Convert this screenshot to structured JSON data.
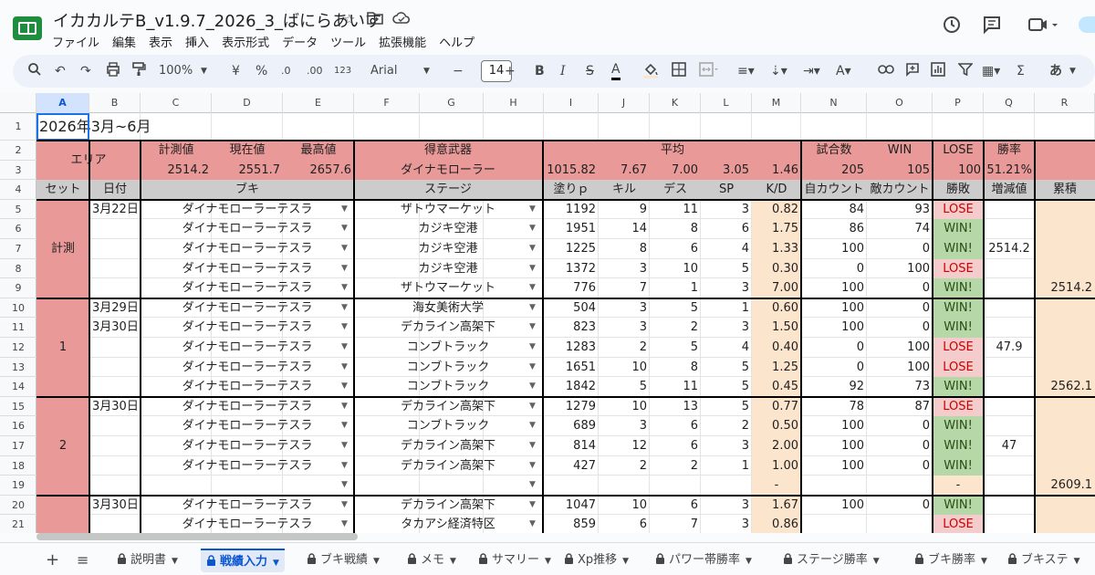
{
  "app": {
    "doc_title": "イカカルテB_v1.9.7_2026_3_ばにらあいす",
    "menu": [
      "ファイル",
      "編集",
      "表示",
      "挿入",
      "表示形式",
      "データ",
      "ツール",
      "拡張機能",
      "ヘルプ"
    ]
  },
  "toolbar": {
    "zoom": "100%",
    "currency": "¥",
    "percent": "%",
    "dec_dec": ".0",
    "dec_inc": ".00",
    "number_format": "123",
    "font": "Arial",
    "font_size": "14",
    "bold": "B",
    "italic": "I",
    "strike": "S",
    "text_color": "A",
    "sigma": "Σ",
    "input_mode": "あ"
  },
  "columns": [
    "A",
    "B",
    "C",
    "D",
    "E",
    "F",
    "G",
    "H",
    "I",
    "J",
    "K",
    "L",
    "M",
    "N",
    "O",
    "P",
    "Q",
    "R"
  ],
  "selected_column": "A",
  "rows": [
    "1",
    "2",
    "3",
    "4",
    "5",
    "6",
    "7",
    "8",
    "9",
    "10",
    "11",
    "12",
    "13",
    "14",
    "15",
    "16",
    "17",
    "18",
    "19",
    "20",
    "21"
  ],
  "sheet": {
    "title": "2026年3月~6月",
    "header": {
      "area": "エリア",
      "measured": "計測値",
      "current": "現在値",
      "max": "最高値",
      "fav_weapon": "得意武器",
      "average": "平均",
      "matches": "試合数",
      "win": "WIN",
      "lose": "LOSE",
      "win_rate": "勝率"
    },
    "summary": {
      "measured": "2514.2",
      "current": "2551.7",
      "max": "2657.6",
      "fav_weapon": "ダイナモローラー",
      "avg_paint": "1015.82",
      "avg_kill": "7.67",
      "avg_death": "7.00",
      "avg_sp": "3.05",
      "avg_kd": "1.46",
      "matches": "205",
      "win": "105",
      "lose": "100",
      "win_rate": "51.21%"
    },
    "columns": {
      "set": "セット",
      "date": "日付",
      "weapon": "ブキ",
      "stage": "ステージ",
      "paint": "塗りｐ",
      "kill": "キル",
      "death": "デス",
      "sp": "SP",
      "kd": "K/D",
      "our_count": "自カウント",
      "enemy_count": "敵カウント",
      "result": "勝敗",
      "delta": "増減値",
      "cumulative": "累積"
    },
    "groups": [
      {
        "label": "計測",
        "delta": "2514.2",
        "cumulative": "2514.2"
      },
      {
        "label": "1",
        "delta": "47.9",
        "cumulative": "2562.1"
      },
      {
        "label": "2",
        "delta": "47",
        "cumulative": "2609.1"
      }
    ],
    "data_rows": [
      {
        "date": "3月22日",
        "weapon": "ダイナモローラーテスラ",
        "stage": "ザトウマーケット",
        "paint": "1192",
        "kill": "9",
        "death": "11",
        "sp": "3",
        "kd": "0.82",
        "our": "84",
        "enemy": "93",
        "result": "LOSE"
      },
      {
        "date": "",
        "weapon": "ダイナモローラーテスラ",
        "stage": "カジキ空港",
        "paint": "1951",
        "kill": "14",
        "death": "8",
        "sp": "6",
        "kd": "1.75",
        "our": "86",
        "enemy": "74",
        "result": "WIN!"
      },
      {
        "date": "",
        "weapon": "ダイナモローラーテスラ",
        "stage": "カジキ空港",
        "paint": "1225",
        "kill": "8",
        "death": "6",
        "sp": "4",
        "kd": "1.33",
        "our": "100",
        "enemy": "0",
        "result": "WIN!"
      },
      {
        "date": "",
        "weapon": "ダイナモローラーテスラ",
        "stage": "カジキ空港",
        "paint": "1372",
        "kill": "3",
        "death": "10",
        "sp": "5",
        "kd": "0.30",
        "our": "0",
        "enemy": "100",
        "result": "LOSE"
      },
      {
        "date": "",
        "weapon": "ダイナモローラーテスラ",
        "stage": "ザトウマーケット",
        "paint": "776",
        "kill": "7",
        "death": "1",
        "sp": "3",
        "kd": "7.00",
        "our": "100",
        "enemy": "0",
        "result": "WIN!"
      },
      {
        "date": "3月29日",
        "weapon": "ダイナモローラーテスラ",
        "stage": "海女美術大学",
        "paint": "504",
        "kill": "3",
        "death": "5",
        "sp": "1",
        "kd": "0.60",
        "our": "100",
        "enemy": "0",
        "result": "WIN!"
      },
      {
        "date": "3月30日",
        "weapon": "ダイナモローラーテスラ",
        "stage": "デカライン高架下",
        "paint": "823",
        "kill": "3",
        "death": "2",
        "sp": "3",
        "kd": "1.50",
        "our": "100",
        "enemy": "0",
        "result": "WIN!"
      },
      {
        "date": "",
        "weapon": "ダイナモローラーテスラ",
        "stage": "コンブトラック",
        "paint": "1283",
        "kill": "2",
        "death": "5",
        "sp": "4",
        "kd": "0.40",
        "our": "0",
        "enemy": "100",
        "result": "LOSE"
      },
      {
        "date": "",
        "weapon": "ダイナモローラーテスラ",
        "stage": "コンブトラック",
        "paint": "1651",
        "kill": "10",
        "death": "8",
        "sp": "5",
        "kd": "1.25",
        "our": "0",
        "enemy": "100",
        "result": "LOSE"
      },
      {
        "date": "",
        "weapon": "ダイナモローラーテスラ",
        "stage": "コンブトラック",
        "paint": "1842",
        "kill": "5",
        "death": "11",
        "sp": "5",
        "kd": "0.45",
        "our": "92",
        "enemy": "73",
        "result": "WIN!"
      },
      {
        "date": "3月30日",
        "weapon": "ダイナモローラーテスラ",
        "stage": "デカライン高架下",
        "paint": "1279",
        "kill": "10",
        "death": "13",
        "sp": "5",
        "kd": "0.77",
        "our": "78",
        "enemy": "87",
        "result": "LOSE"
      },
      {
        "date": "",
        "weapon": "ダイナモローラーテスラ",
        "stage": "コンブトラック",
        "paint": "689",
        "kill": "3",
        "death": "6",
        "sp": "2",
        "kd": "0.50",
        "our": "100",
        "enemy": "0",
        "result": "WIN!"
      },
      {
        "date": "",
        "weapon": "ダイナモローラーテスラ",
        "stage": "デカライン高架下",
        "paint": "814",
        "kill": "12",
        "death": "6",
        "sp": "3",
        "kd": "2.00",
        "our": "100",
        "enemy": "0",
        "result": "WIN!"
      },
      {
        "date": "",
        "weapon": "ダイナモローラーテスラ",
        "stage": "デカライン高架下",
        "paint": "427",
        "kill": "2",
        "death": "2",
        "sp": "1",
        "kd": "1.00",
        "our": "100",
        "enemy": "0",
        "result": "WIN!"
      },
      {
        "date": "",
        "weapon": "",
        "stage": "",
        "paint": "",
        "kill": "",
        "death": "",
        "sp": "",
        "kd": "-",
        "our": "",
        "enemy": "",
        "result": "-"
      },
      {
        "date": "3月30日",
        "weapon": "ダイナモローラーテスラ",
        "stage": "デカライン高架下",
        "paint": "1047",
        "kill": "10",
        "death": "6",
        "sp": "3",
        "kd": "1.67",
        "our": "100",
        "enemy": "0",
        "result": "WIN!"
      },
      {
        "date": "",
        "weapon": "ダイナモローラーテスラ",
        "stage": "タカアシ経済特区",
        "paint": "859",
        "kill": "6",
        "death": "7",
        "sp": "3",
        "kd": "0.86",
        "our": "",
        "enemy": "",
        "result": "LOSE"
      }
    ]
  },
  "tabs": [
    "説明書",
    "戦績入力",
    "ブキ戦績",
    "メモ",
    "サマリー",
    "Xp推移",
    "パワー帯勝率",
    "ステージ勝率",
    "ブキ勝率",
    "ブキステ"
  ],
  "active_tab": "戦績入力",
  "colors": {
    "header_red": "#ea9999",
    "kd_peach": "#fce5cd",
    "win_green": "#b6d7a8",
    "lose_red": "#f4cccc"
  }
}
